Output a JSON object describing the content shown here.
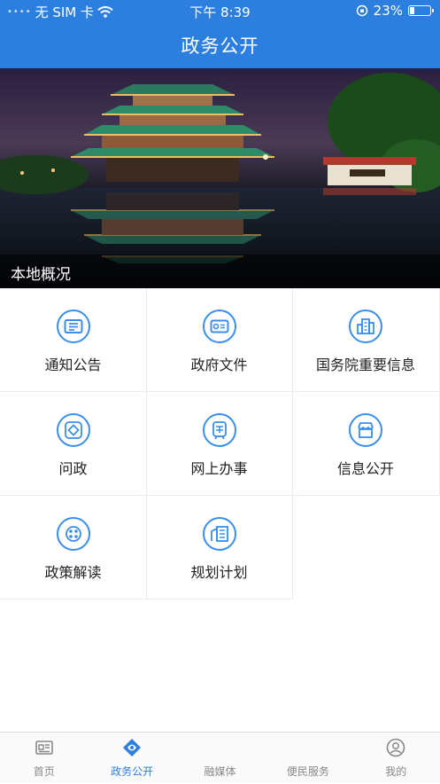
{
  "status_bar": {
    "carrier": "无 SIM 卡",
    "time": "下午 8:39",
    "battery": "23%",
    "battery_level": 0.23
  },
  "header": {
    "title": "政务公开"
  },
  "banner": {
    "caption": "本地概况"
  },
  "menu": [
    {
      "label": "通知公告",
      "icon": "notice-icon"
    },
    {
      "label": "政府文件",
      "icon": "document-icon"
    },
    {
      "label": "国务院重要信息",
      "icon": "buildings-icon"
    },
    {
      "label": "问政",
      "icon": "ask-icon"
    },
    {
      "label": "网上办事",
      "icon": "service-icon"
    },
    {
      "label": "信息公开",
      "icon": "store-icon"
    },
    {
      "label": "政策解读",
      "icon": "policy-icon"
    },
    {
      "label": "规划计划",
      "icon": "plan-icon"
    }
  ],
  "tabbar": {
    "tabs": [
      {
        "label": "首页",
        "icon": "home-icon"
      },
      {
        "label": "政务公开",
        "icon": "gov-icon",
        "active": true
      },
      {
        "label": "融媒体",
        "icon": "media-icon"
      },
      {
        "label": "便民服务",
        "icon": "service-icon"
      },
      {
        "label": "我的",
        "icon": "profile-icon"
      }
    ]
  },
  "colors": {
    "accent": "#2c7fdf",
    "icon_blue": "#3b8eea",
    "text": "#222222",
    "tab_inactive": "#888888"
  }
}
